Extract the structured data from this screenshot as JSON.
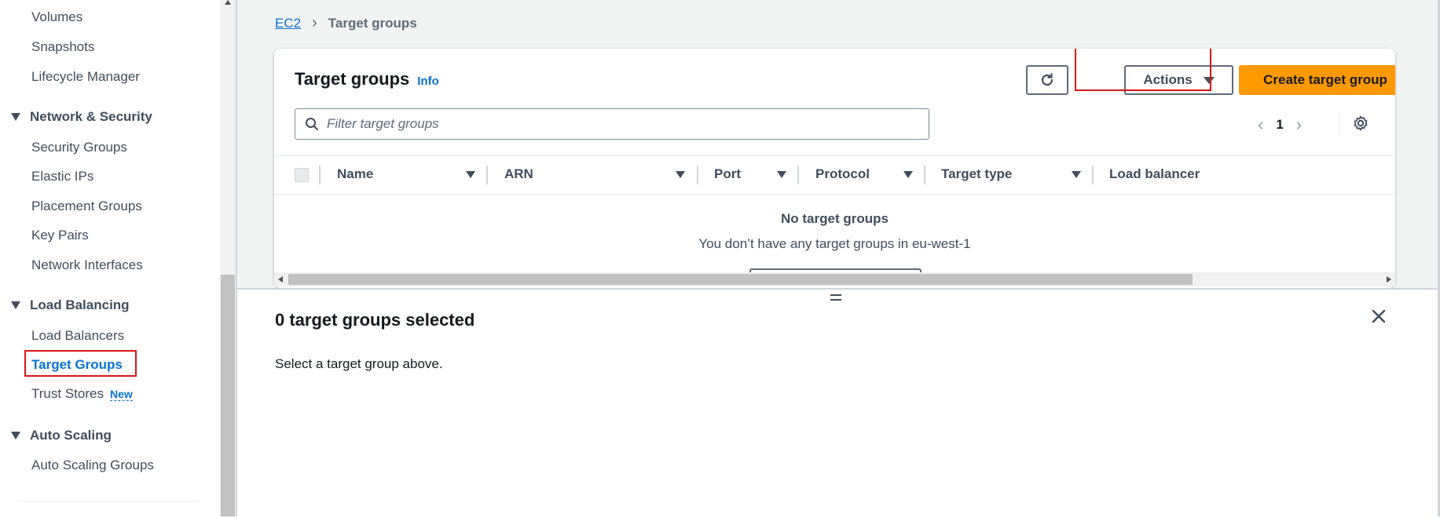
{
  "sidebar": {
    "items_top": [
      "Volumes",
      "Snapshots",
      "Lifecycle Manager"
    ],
    "sections": [
      {
        "title": "Network & Security",
        "items": [
          "Security Groups",
          "Elastic IPs",
          "Placement Groups",
          "Key Pairs",
          "Network Interfaces"
        ]
      },
      {
        "title": "Load Balancing",
        "items": [
          "Load Balancers",
          "Target Groups",
          "Trust Stores"
        ]
      },
      {
        "title": "Auto Scaling",
        "items": [
          "Auto Scaling Groups"
        ]
      }
    ],
    "active_item": "Target Groups",
    "new_badge": "New"
  },
  "breadcrumb": {
    "root": "EC2",
    "current": "Target groups"
  },
  "panel": {
    "title": "Target groups",
    "info": "Info",
    "actions_label": "Actions",
    "create_label": "Create target group",
    "filter_placeholder": "Filter target groups",
    "page_number": "1",
    "columns": [
      "Name",
      "ARN",
      "Port",
      "Protocol",
      "Target type",
      "Load balancer"
    ],
    "empty_title": "No target groups",
    "empty_desc": "You don’t have any target groups in eu-west-1"
  },
  "split_panel": {
    "title": "0 target groups selected",
    "description": "Select a target group above."
  },
  "colors": {
    "primary": "#ff9900",
    "link": "#0972d3",
    "highlight": "#d91515"
  }
}
